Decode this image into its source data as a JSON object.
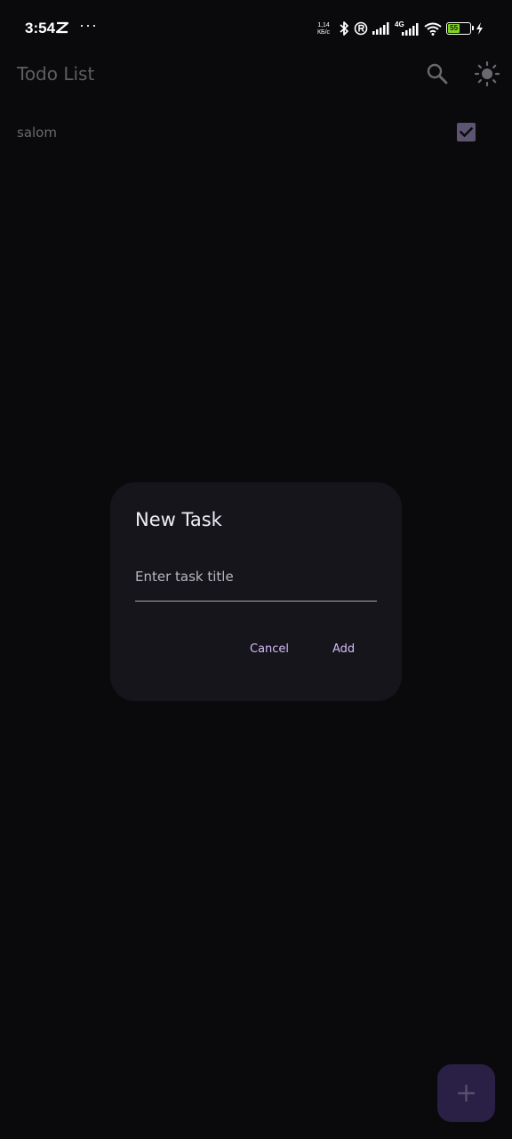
{
  "status_bar": {
    "time": "3:54",
    "more": "···",
    "netspeed_value": "1,14",
    "netspeed_unit": "КБ/с",
    "network_label": "4G",
    "battery_level": "55",
    "icons": [
      "capcut-icon",
      "bluetooth-icon",
      "registered-icon",
      "signal-icon",
      "signal-4g-icon",
      "wifi-icon",
      "battery-icon",
      "charging-icon"
    ]
  },
  "app_bar": {
    "title": "Todo List",
    "actions": [
      "search-icon",
      "sun-icon"
    ]
  },
  "tasks": [
    {
      "title": "salom",
      "completed": true
    }
  ],
  "dialog": {
    "title": "New Task",
    "input_placeholder": "Enter task title",
    "input_value": "",
    "cancel_label": "Cancel",
    "add_label": "Add"
  },
  "fab": {
    "icon": "plus-icon"
  },
  "colors": {
    "background": "#0a0a0c",
    "dialog_background": "#17151c",
    "accent": "#d3bbf7",
    "fab_background": "#2a1f45",
    "checkbox": "#5c5470"
  }
}
